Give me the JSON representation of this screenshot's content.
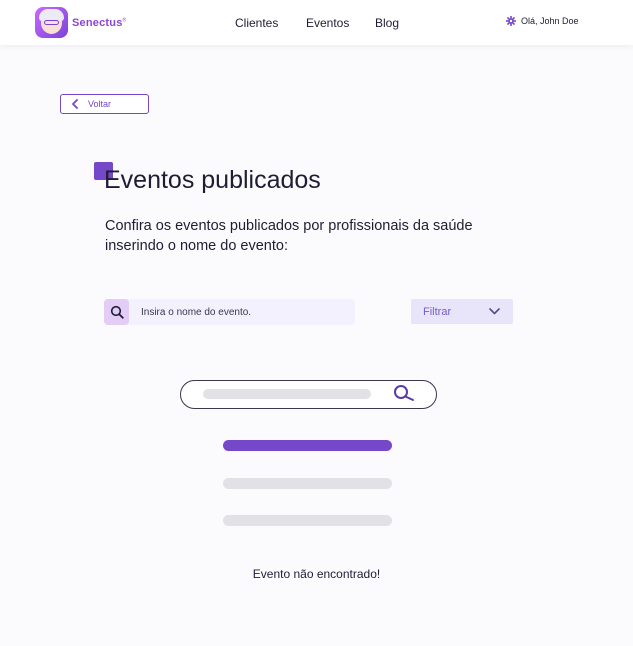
{
  "header": {
    "brand": "Senectus",
    "brand_mark": "®",
    "nav": [
      "Clientes",
      "Eventos",
      "Blog"
    ],
    "user_greeting": "Olá, John Doe",
    "user_icon": "gear-icon"
  },
  "back_button": {
    "label": "Voltar",
    "icon": "chevron-left-icon"
  },
  "main": {
    "title": "Eventos publicados",
    "subtitle": "Confira os eventos publicados por profissionais da saúde inserindo o nome do evento:",
    "search": {
      "placeholder": "Insira o nome do evento.",
      "value": "",
      "icon": "search-icon"
    },
    "filter": {
      "label": "Filtrar",
      "icon": "chevron-down-icon"
    }
  },
  "empty_state": {
    "message": "Evento não encontrado!",
    "illustration": "empty-search-illustration"
  },
  "colors": {
    "accent": "#7547c9",
    "accent_light": "#e3cdf7",
    "background": "#fbfbfd",
    "text": "#1f1d33"
  }
}
